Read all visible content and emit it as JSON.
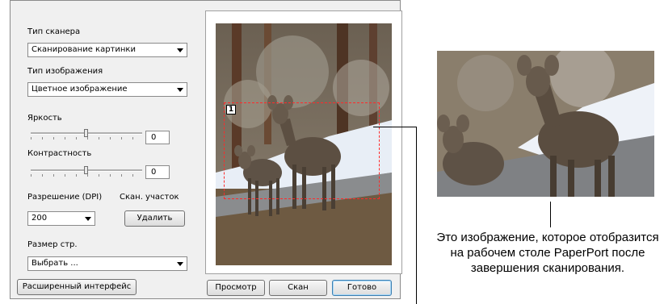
{
  "dialog": {
    "scanner_type": {
      "label": "Тип сканера",
      "value": "Сканирование картинки"
    },
    "image_type": {
      "label": "Тип изображения",
      "value": "Цветное изображение"
    },
    "brightness": {
      "label": "Яркость",
      "value": "0"
    },
    "contrast": {
      "label": "Контрастность",
      "value": "0"
    },
    "resolution": {
      "label": "Разрешение (DPI)",
      "value": "200"
    },
    "scan_area": {
      "label": "Скан. участок",
      "delete_label": "Удалить"
    },
    "page_size": {
      "label": "Размер стр.",
      "value": "Выбрать ..."
    },
    "buttons": {
      "advanced": "Расширенный интерфейс",
      "preview": "Просмотр",
      "scan": "Скан",
      "done": "Готово"
    },
    "region_number": "1"
  },
  "callout": {
    "caption": "Это изображение, которое отобразится на рабочем столе PaperPort после завершения сканирования."
  },
  "colors": {
    "accent": "#3c7fb1",
    "selection": "#ff2a2a",
    "dialog_bg": "#f0f0f0"
  }
}
